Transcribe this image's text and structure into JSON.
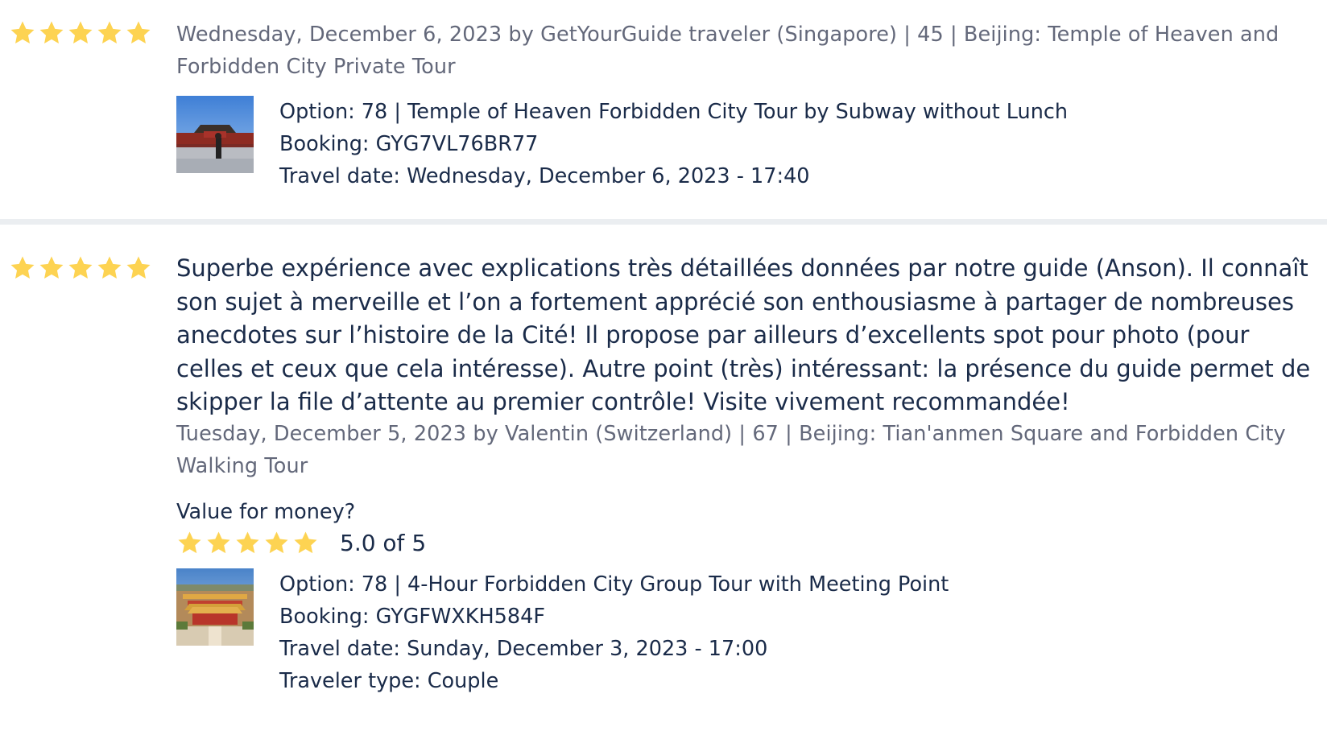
{
  "colors": {
    "star": "#fdd352",
    "text_primary": "#1a2b49",
    "text_secondary": "#63687a",
    "divider": "#ebeef1"
  },
  "reviews": [
    {
      "rating": 5,
      "meta": "Wednesday, December 6, 2023 by GetYourGuide traveler (Singapore) | 45 | Beijing: Temple of Heaven and Forbidden City Private Tour",
      "thumbnail_icon": "forbidden-city-photo",
      "option": "Option: 78 | Temple of Heaven Forbidden City Tour by Subway without Lunch",
      "booking": "Booking: GYG7VL76BR77",
      "travel_date": "Travel date: Wednesday, December 6, 2023 - 17:40"
    },
    {
      "rating": 5,
      "text": "Superbe expérience avec explications très détaillées données par notre guide (Anson). Il connaît son sujet à merveille et l’on a fortement apprécié son enthousiasme à partager de nombreuses anecdotes sur l’histoire de la Cité! Il propose par ailleurs d’excellents spot pour photo (pour celles et ceux que cela intéresse). Autre point (très) intéressant: la présence du guide permet de skipper la file d’attente au premier contrôle! Visite vivement recommandée!",
      "meta": "Tuesday, December 5, 2023 by Valentin (Switzerland) | 67 | Beijing: Tian'anmen Square and Forbidden City Walking Tour",
      "value_for_money_label": "Value for money?",
      "value_for_money_rating": 5,
      "value_for_money_score": "5.0 of 5",
      "thumbnail_icon": "forbidden-city-aerial-photo",
      "option": "Option: 78 | 4-Hour Forbidden City Group Tour with Meeting Point",
      "booking": "Booking: GYGFWXKH584F",
      "travel_date": "Travel date: Sunday, December 3, 2023 - 17:00",
      "traveler_type": "Traveler type: Couple"
    }
  ]
}
